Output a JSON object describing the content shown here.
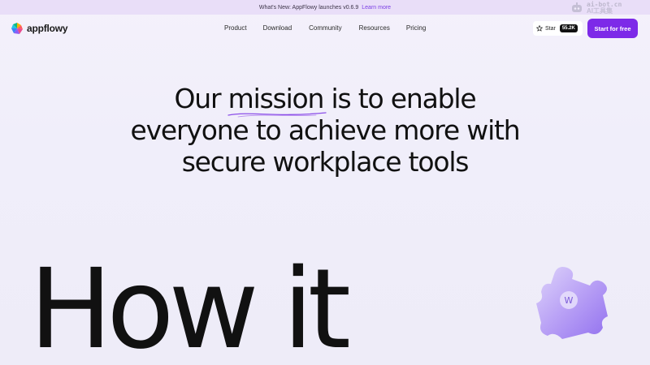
{
  "announcement": {
    "text": "What's New: AppFlowy launches v0.6.9",
    "link": "Learn more"
  },
  "watermark": {
    "line1": "ai-bot.cn",
    "line2": "AI工具集"
  },
  "brand": {
    "name": "appflowy",
    "accent": "#7d2ae8"
  },
  "nav": {
    "items": [
      "Product",
      "Download",
      "Community",
      "Resources",
      "Pricing"
    ]
  },
  "github": {
    "star_label": "Star",
    "star_count": "55.2K"
  },
  "cta": {
    "label": "Start for free"
  },
  "hero": {
    "line1_a": "Our ",
    "line1_highlight": "mission",
    "line1_b": " is to enable",
    "line2": "everyone to achieve more with",
    "line3": "secure workplace tools"
  },
  "section": {
    "heading": "How it"
  },
  "icons": {
    "star": "star-icon",
    "logo": "appflowy-logo-icon",
    "puzzle": "puzzle-piece-icon"
  },
  "puzzle_letter": "W"
}
